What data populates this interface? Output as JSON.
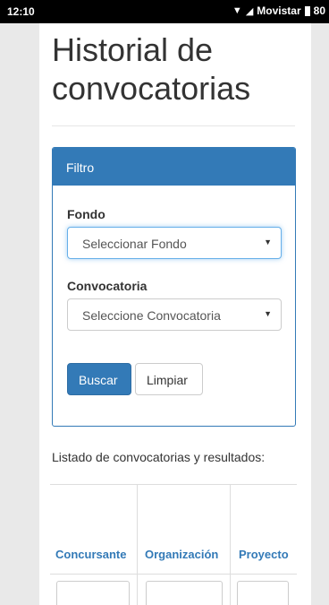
{
  "status_bar": {
    "time": "12:10",
    "carrier": "Movistar",
    "battery": "80"
  },
  "page": {
    "title": "Historial de convocatorias"
  },
  "filter_panel": {
    "heading": "Filtro",
    "fondo_label": "Fondo",
    "fondo_selected": "Seleccionar Fondo",
    "convocatoria_label": "Convocatoria",
    "convocatoria_selected": "Seleccione Convocatoria",
    "search_button": "Buscar",
    "clear_button": "Limpiar"
  },
  "listing": {
    "caption": "Listado de convocatorias y resultados:",
    "columns": [
      "Concursante",
      "Organización",
      "Proyecto"
    ]
  },
  "colors": {
    "primary": "#337ab7",
    "status_bar": "#000000",
    "background": "#e9e9e9"
  }
}
